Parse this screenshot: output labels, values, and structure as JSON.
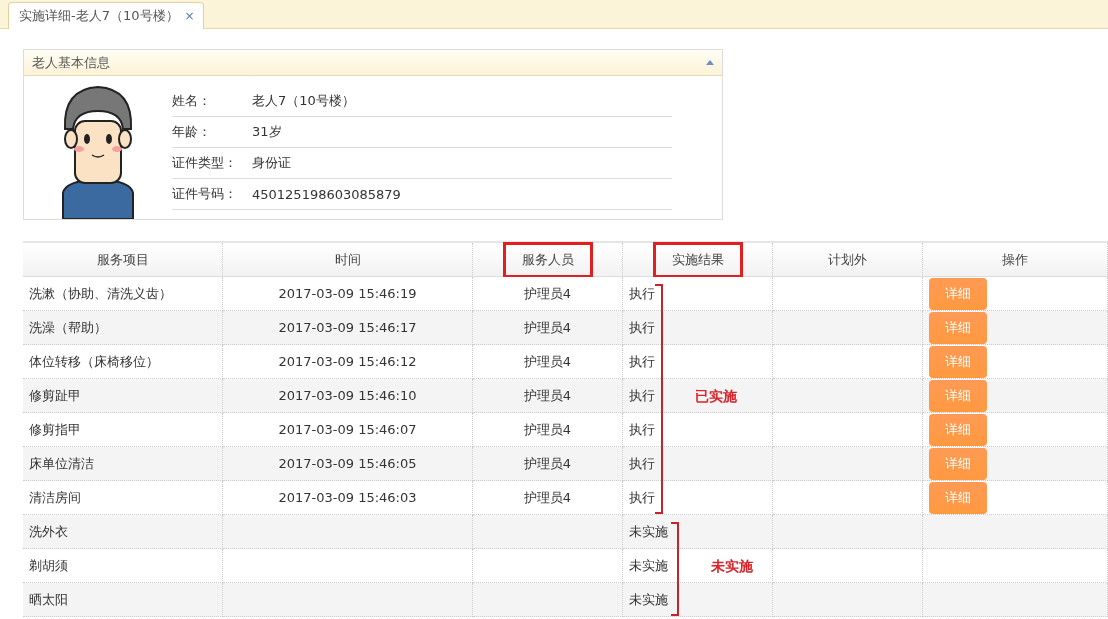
{
  "tabs": [
    {
      "label": "实施详细-老人7（10号楼）",
      "close": "×",
      "selected": true
    }
  ],
  "info_panel": {
    "title": "老人基本信息",
    "fields": [
      {
        "label": "姓名：",
        "value": "老人7（10号楼）"
      },
      {
        "label": "年龄：",
        "value": "31岁"
      },
      {
        "label": "证件类型：",
        "value": "身份证"
      },
      {
        "label": "证件号码：",
        "value": "450125198603085879"
      }
    ]
  },
  "table": {
    "columns": [
      {
        "label": "服务项目",
        "highlighted": false
      },
      {
        "label": "时间",
        "highlighted": false
      },
      {
        "label": "服务人员",
        "highlighted": true
      },
      {
        "label": "实施结果",
        "highlighted": true
      },
      {
        "label": "计划外",
        "highlighted": false
      },
      {
        "label": "操作",
        "highlighted": false
      }
    ],
    "rows": [
      {
        "kind": "done",
        "item": "洗漱（协助、清洗义齿）",
        "time": "2017-03-09 15:46:19",
        "staff": "护理员4",
        "result": "执行",
        "action": "详细"
      },
      {
        "kind": "done",
        "item": "洗澡（帮助）",
        "time": "2017-03-09 15:46:17",
        "staff": "护理员4",
        "result": "执行",
        "action": "详细"
      },
      {
        "kind": "done",
        "item": "体位转移（床椅移位）",
        "time": "2017-03-09 15:46:12",
        "staff": "护理员4",
        "result": "执行",
        "action": "详细"
      },
      {
        "kind": "done",
        "item": "修剪趾甲",
        "time": "2017-03-09 15:46:10",
        "staff": "护理员4",
        "result": "执行",
        "action": "详细"
      },
      {
        "kind": "done",
        "item": "修剪指甲",
        "time": "2017-03-09 15:46:07",
        "staff": "护理员4",
        "result": "执行",
        "action": "详细"
      },
      {
        "kind": "done",
        "item": "床单位清洁",
        "time": "2017-03-09 15:46:05",
        "staff": "护理员4",
        "result": "执行",
        "action": "详细"
      },
      {
        "kind": "done",
        "item": "清洁房间",
        "time": "2017-03-09 15:46:03",
        "staff": "护理员4",
        "result": "执行",
        "action": "详细"
      },
      {
        "kind": "pending",
        "item": "洗外衣",
        "result": "未实施"
      },
      {
        "kind": "pending",
        "item": "剃胡须",
        "result": "未实施"
      },
      {
        "kind": "pending",
        "item": "晒太阳",
        "result": "未实施"
      }
    ]
  },
  "annotations": [
    {
      "kind": "done",
      "label": "已实施"
    },
    {
      "kind": "pending",
      "label": "未实施"
    }
  ]
}
